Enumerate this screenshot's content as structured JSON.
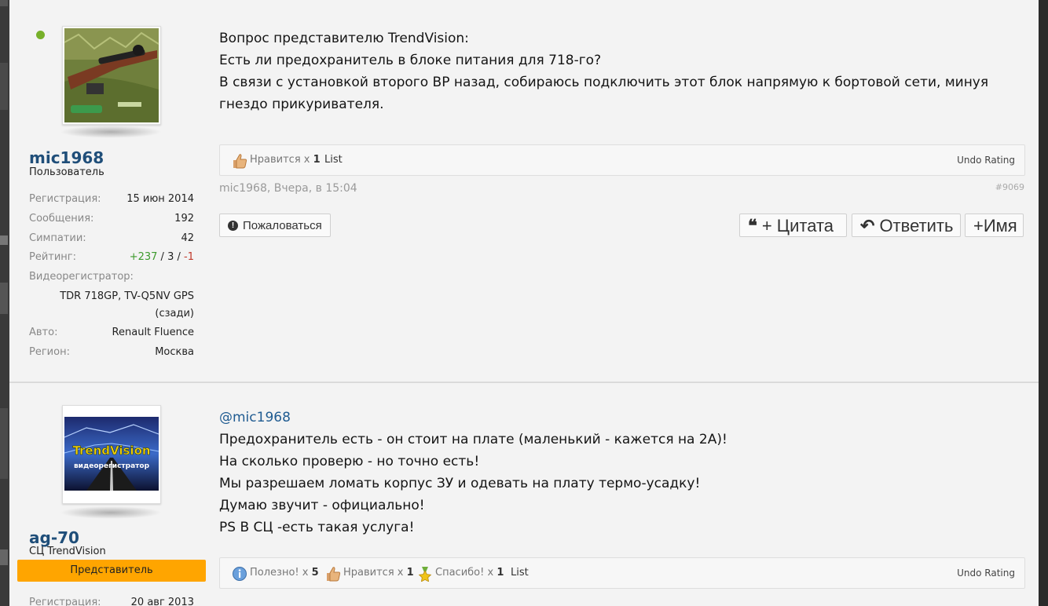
{
  "posts": [
    {
      "user": {
        "name": "mic1968",
        "title": "Пользователь",
        "info": [
          {
            "label": "Регистрация:",
            "value": "15 июн 2014"
          },
          {
            "label": "Сообщения:",
            "value": "192"
          },
          {
            "label": "Симпатии:",
            "value": "42"
          }
        ],
        "rating_label": "Рейтинг:",
        "rating_pos": "+237",
        "rating_mid": "3",
        "rating_neg": "-1",
        "rating_sep": "/",
        "dvr_label": "Видеорегистратор:",
        "dvr_value_1": "TDR 718GP, TV-Q5NV GPS",
        "dvr_value_2": "(сзади)",
        "car_label": "Авто:",
        "car_value": "Renault Fluence",
        "region_label": "Регион:",
        "region_value": "Москва"
      },
      "message": [
        "Вопрос представителю TrendVision:",
        "Есть ли предохранитель в блоке питания для 718-го?",
        "В связи с установкой второго ВР назад, собираюсь подключить этот блок напрямую к бортовой сети, минуя",
        "гнездо прикуривателя."
      ],
      "ratings": {
        "like_label": "Нравится",
        "like_x": "x",
        "like_count": "1",
        "list": "List",
        "undo": "Undo Rating"
      },
      "meta_author": "mic1968,",
      "meta_date": "Вчера, в 15:04",
      "post_number": "#9069",
      "report": "Пожаловаться",
      "quote": "+ Цитата",
      "reply": "Ответить",
      "name_btn": "+Имя"
    },
    {
      "user": {
        "name": "ag-70",
        "title": "СЦ TrendVision",
        "rank": "Представитель",
        "reg_label": "Регистрация:",
        "reg_value": "20 авг 2013",
        "avatar_text_1": "TrendVision",
        "avatar_text_2": "видеорегистратор"
      },
      "mention": "@mic1968",
      "message": [
        "Предохранитель есть - он стоит на плате (маленький - кажется на 2А)!",
        "На сколько проверю - но точно есть!",
        "Мы разрешаем ломать корпус ЗУ и одевать на плату термо-усадку!",
        "Думаю звучит - официально!",
        "PS В СЦ -есть такая услуга!"
      ],
      "ratings": {
        "useful_label": "Полезно!",
        "useful_count": "5",
        "like_label": "Нравится",
        "like_count": "1",
        "thanks_label": "Спасибо!",
        "thanks_count": "1",
        "x": "x",
        "list": "List",
        "undo": "Undo Rating"
      }
    }
  ]
}
